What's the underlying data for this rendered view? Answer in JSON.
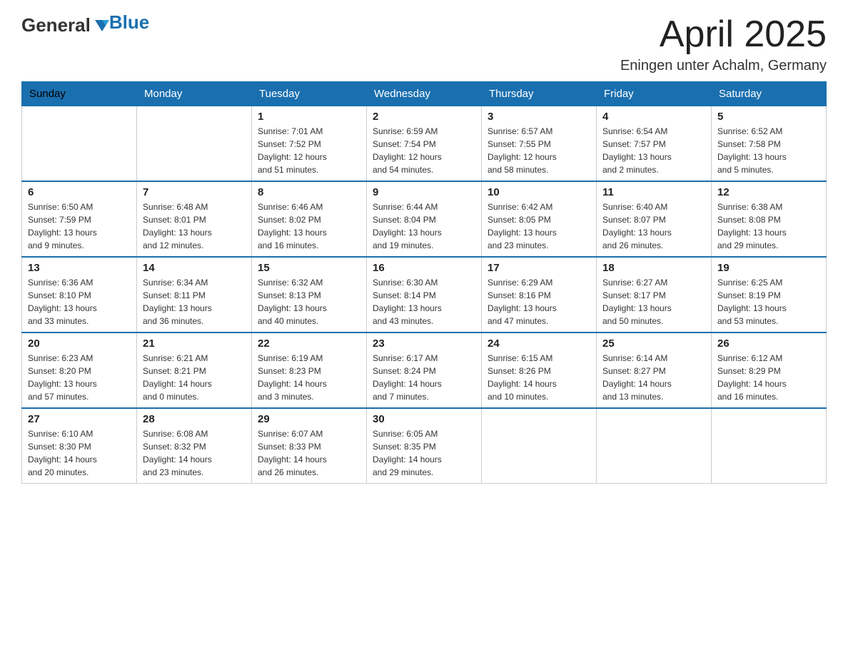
{
  "header": {
    "logo_general": "General",
    "logo_blue": "Blue",
    "month": "April 2025",
    "location": "Eningen unter Achalm, Germany"
  },
  "weekdays": [
    "Sunday",
    "Monday",
    "Tuesday",
    "Wednesday",
    "Thursday",
    "Friday",
    "Saturday"
  ],
  "weeks": [
    [
      {
        "day": "",
        "info": ""
      },
      {
        "day": "",
        "info": ""
      },
      {
        "day": "1",
        "info": "Sunrise: 7:01 AM\nSunset: 7:52 PM\nDaylight: 12 hours\nand 51 minutes."
      },
      {
        "day": "2",
        "info": "Sunrise: 6:59 AM\nSunset: 7:54 PM\nDaylight: 12 hours\nand 54 minutes."
      },
      {
        "day": "3",
        "info": "Sunrise: 6:57 AM\nSunset: 7:55 PM\nDaylight: 12 hours\nand 58 minutes."
      },
      {
        "day": "4",
        "info": "Sunrise: 6:54 AM\nSunset: 7:57 PM\nDaylight: 13 hours\nand 2 minutes."
      },
      {
        "day": "5",
        "info": "Sunrise: 6:52 AM\nSunset: 7:58 PM\nDaylight: 13 hours\nand 5 minutes."
      }
    ],
    [
      {
        "day": "6",
        "info": "Sunrise: 6:50 AM\nSunset: 7:59 PM\nDaylight: 13 hours\nand 9 minutes."
      },
      {
        "day": "7",
        "info": "Sunrise: 6:48 AM\nSunset: 8:01 PM\nDaylight: 13 hours\nand 12 minutes."
      },
      {
        "day": "8",
        "info": "Sunrise: 6:46 AM\nSunset: 8:02 PM\nDaylight: 13 hours\nand 16 minutes."
      },
      {
        "day": "9",
        "info": "Sunrise: 6:44 AM\nSunset: 8:04 PM\nDaylight: 13 hours\nand 19 minutes."
      },
      {
        "day": "10",
        "info": "Sunrise: 6:42 AM\nSunset: 8:05 PM\nDaylight: 13 hours\nand 23 minutes."
      },
      {
        "day": "11",
        "info": "Sunrise: 6:40 AM\nSunset: 8:07 PM\nDaylight: 13 hours\nand 26 minutes."
      },
      {
        "day": "12",
        "info": "Sunrise: 6:38 AM\nSunset: 8:08 PM\nDaylight: 13 hours\nand 29 minutes."
      }
    ],
    [
      {
        "day": "13",
        "info": "Sunrise: 6:36 AM\nSunset: 8:10 PM\nDaylight: 13 hours\nand 33 minutes."
      },
      {
        "day": "14",
        "info": "Sunrise: 6:34 AM\nSunset: 8:11 PM\nDaylight: 13 hours\nand 36 minutes."
      },
      {
        "day": "15",
        "info": "Sunrise: 6:32 AM\nSunset: 8:13 PM\nDaylight: 13 hours\nand 40 minutes."
      },
      {
        "day": "16",
        "info": "Sunrise: 6:30 AM\nSunset: 8:14 PM\nDaylight: 13 hours\nand 43 minutes."
      },
      {
        "day": "17",
        "info": "Sunrise: 6:29 AM\nSunset: 8:16 PM\nDaylight: 13 hours\nand 47 minutes."
      },
      {
        "day": "18",
        "info": "Sunrise: 6:27 AM\nSunset: 8:17 PM\nDaylight: 13 hours\nand 50 minutes."
      },
      {
        "day": "19",
        "info": "Sunrise: 6:25 AM\nSunset: 8:19 PM\nDaylight: 13 hours\nand 53 minutes."
      }
    ],
    [
      {
        "day": "20",
        "info": "Sunrise: 6:23 AM\nSunset: 8:20 PM\nDaylight: 13 hours\nand 57 minutes."
      },
      {
        "day": "21",
        "info": "Sunrise: 6:21 AM\nSunset: 8:21 PM\nDaylight: 14 hours\nand 0 minutes."
      },
      {
        "day": "22",
        "info": "Sunrise: 6:19 AM\nSunset: 8:23 PM\nDaylight: 14 hours\nand 3 minutes."
      },
      {
        "day": "23",
        "info": "Sunrise: 6:17 AM\nSunset: 8:24 PM\nDaylight: 14 hours\nand 7 minutes."
      },
      {
        "day": "24",
        "info": "Sunrise: 6:15 AM\nSunset: 8:26 PM\nDaylight: 14 hours\nand 10 minutes."
      },
      {
        "day": "25",
        "info": "Sunrise: 6:14 AM\nSunset: 8:27 PM\nDaylight: 14 hours\nand 13 minutes."
      },
      {
        "day": "26",
        "info": "Sunrise: 6:12 AM\nSunset: 8:29 PM\nDaylight: 14 hours\nand 16 minutes."
      }
    ],
    [
      {
        "day": "27",
        "info": "Sunrise: 6:10 AM\nSunset: 8:30 PM\nDaylight: 14 hours\nand 20 minutes."
      },
      {
        "day": "28",
        "info": "Sunrise: 6:08 AM\nSunset: 8:32 PM\nDaylight: 14 hours\nand 23 minutes."
      },
      {
        "day": "29",
        "info": "Sunrise: 6:07 AM\nSunset: 8:33 PM\nDaylight: 14 hours\nand 26 minutes."
      },
      {
        "day": "30",
        "info": "Sunrise: 6:05 AM\nSunset: 8:35 PM\nDaylight: 14 hours\nand 29 minutes."
      },
      {
        "day": "",
        "info": ""
      },
      {
        "day": "",
        "info": ""
      },
      {
        "day": "",
        "info": ""
      }
    ]
  ]
}
